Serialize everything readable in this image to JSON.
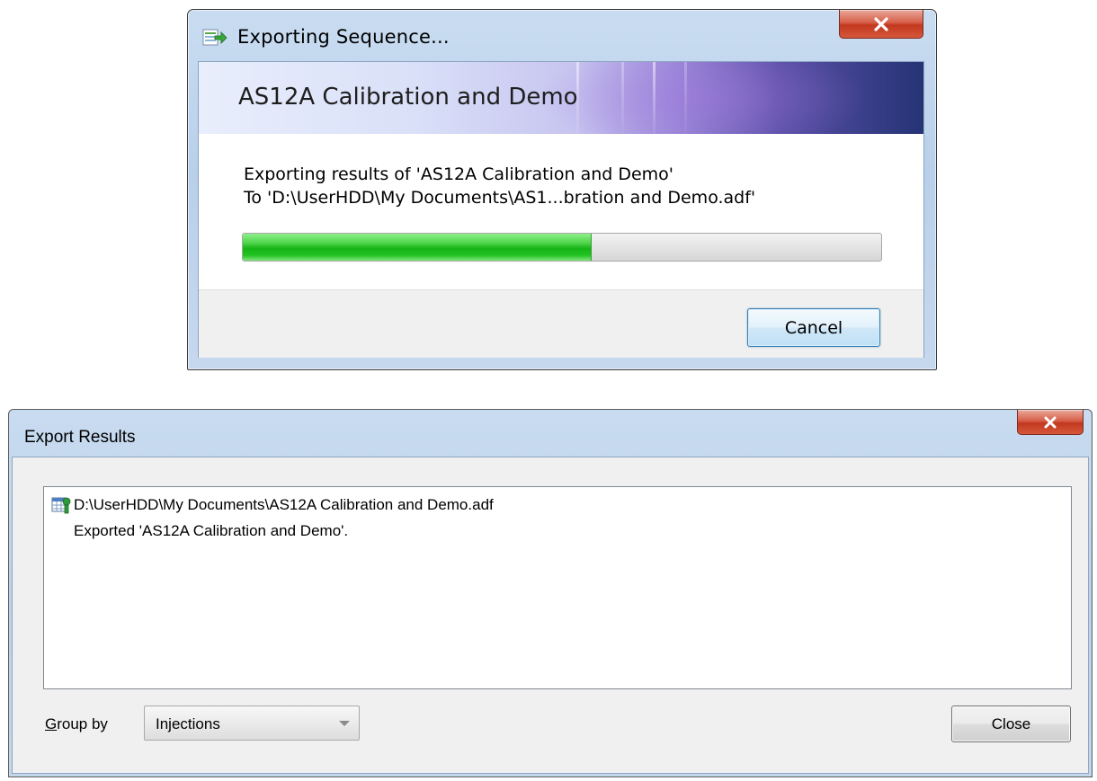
{
  "export_dialog": {
    "title": "Exporting Sequence...",
    "banner_title": "AS12A Calibration and Demo",
    "message_line1": "Exporting results of 'AS12A Calibration and Demo'",
    "message_line2": "To 'D:\\UserHDD\\My Documents\\AS1...bration and Demo.adf'",
    "progress_fraction": 0.545,
    "cancel_label": "Cancel",
    "icons": {
      "app": "export-sequence-icon",
      "close": "close-icon"
    }
  },
  "results_dialog": {
    "title": "Export Results",
    "results": [
      {
        "path": "D:\\UserHDD\\My Documents\\AS12A Calibration and Demo.adf",
        "detail": "Exported 'AS12A Calibration and Demo'."
      }
    ],
    "group_by_label_accel": "G",
    "group_by_label_rest": "roup by",
    "group_by_value": "Injections",
    "close_label": "Close",
    "icons": {
      "document": "data-file-icon",
      "close": "close-icon",
      "dropdown": "chevron-down-icon"
    }
  },
  "colors": {
    "progress_green": "#16b316",
    "close_button_red": "#c2381f",
    "titlebar_blue": "#b9d0ea",
    "banner_dark": "#253475"
  }
}
